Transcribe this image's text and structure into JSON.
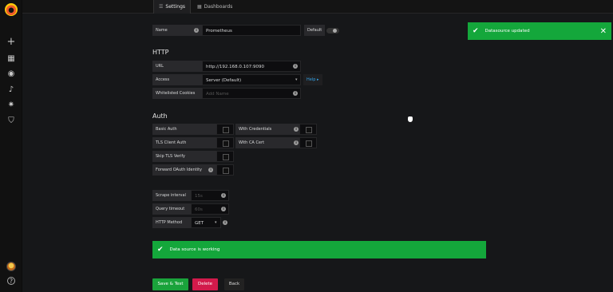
{
  "tabs": [
    {
      "label": "Settings",
      "icon": "sliders-icon"
    },
    {
      "label": "Dashboards",
      "icon": "grid-icon"
    }
  ],
  "form": {
    "name_label": "Name",
    "name_value": "Prometheus",
    "default_label": "Default",
    "http_heading": "HTTP",
    "url_label": "URL",
    "url_value": "http://192.168.0.107:9090",
    "access_label": "Access",
    "access_value": "Server (Default)",
    "help_label": "Help ▸",
    "whitelisted_label": "Whitelisted Cookies",
    "whitelisted_placeholder": "Add Name",
    "auth_heading": "Auth",
    "basic_auth": "Basic Auth",
    "with_credentials": "With Credentials",
    "tls_client_auth": "TLS Client Auth",
    "with_ca_cert": "With CA Cert",
    "skip_tls": "Skip TLS Verify",
    "forward_oauth": "Forward OAuth Identity",
    "scrape_label": "Scrape interval",
    "scrape_placeholder": "15s",
    "query_label": "Query timeout",
    "query_placeholder": "60s",
    "method_label": "HTTP Method",
    "method_value": "GET"
  },
  "alerts": {
    "toast": "Datasource updated",
    "working": "Data source is working"
  },
  "buttons": {
    "save": "Save & Test",
    "delete": "Delete",
    "back": "Back"
  },
  "colors": {
    "success": "#14a73b",
    "danger": "#d21a4b",
    "link": "#33a2e5"
  }
}
